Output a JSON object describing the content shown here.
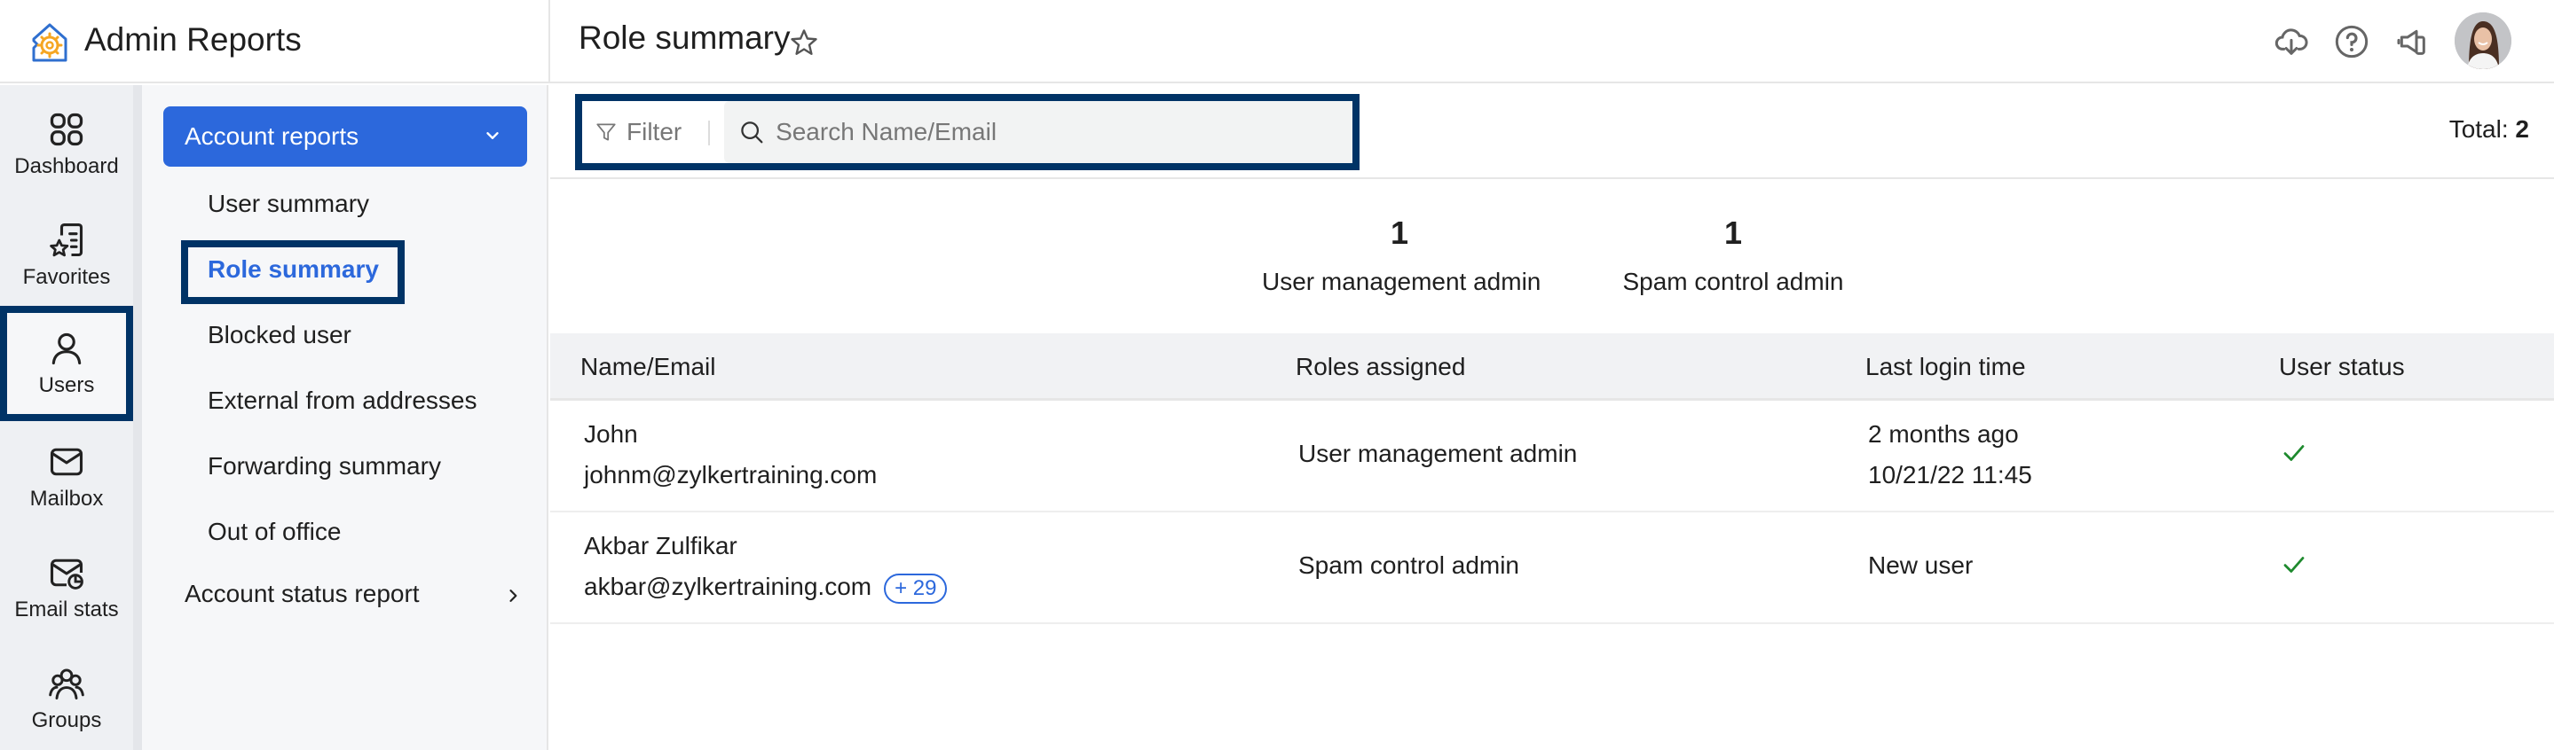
{
  "app": {
    "title": "Admin Reports",
    "logo_icon": "admin-reports-logo-icon"
  },
  "header": {
    "page_title": "Role summary",
    "favorite_icon": "star-icon",
    "actions": [
      {
        "name": "download",
        "icon": "cloud-download-icon"
      },
      {
        "name": "help",
        "icon": "help-icon"
      },
      {
        "name": "announcements",
        "icon": "megaphone-icon"
      }
    ],
    "avatar_icon": "user-avatar"
  },
  "rail": {
    "items": [
      {
        "label": "Dashboard",
        "icon": "grid-icon",
        "active": false
      },
      {
        "label": "Favorites",
        "icon": "favorites-list-icon",
        "active": false
      },
      {
        "label": "Users",
        "icon": "user-icon",
        "active": true
      },
      {
        "label": "Mailbox",
        "icon": "mail-icon",
        "active": false
      },
      {
        "label": "Email stats",
        "icon": "mail-stats-icon",
        "active": false
      },
      {
        "label": "Groups",
        "icon": "group-icon",
        "active": false
      }
    ]
  },
  "subnav": {
    "group_label": "Account reports",
    "items": [
      {
        "label": "User summary",
        "active": false
      },
      {
        "label": "Role summary",
        "active": true
      },
      {
        "label": "Blocked user",
        "active": false
      },
      {
        "label": "External from addresses",
        "active": false
      },
      {
        "label": "Forwarding summary",
        "active": false
      },
      {
        "label": "Out of office",
        "active": false
      }
    ],
    "group2_label": "Account status report"
  },
  "toolbar": {
    "filter_label": "Filter",
    "search_placeholder": "Search Name/Email",
    "search_value": "",
    "total_label": "Total:",
    "total_value": "2"
  },
  "stats": [
    {
      "count": "1",
      "label": "User management admin"
    },
    {
      "count": "1",
      "label": "Spam control admin"
    }
  ],
  "table": {
    "columns": [
      "Name/Email",
      "Roles assigned",
      "Last login time",
      "User status"
    ],
    "rows": [
      {
        "name": "John",
        "email": "johnm@zylkertraining.com",
        "extra_badge": "",
        "role": "User management admin",
        "last_login": "2 months ago",
        "last_login_time": "10/21/22 11:45",
        "status": "active"
      },
      {
        "name": "Akbar Zulfikar",
        "email": "akbar@zylkertraining.com",
        "extra_badge": "+ 29",
        "role": "Spam control admin",
        "last_login": "New user",
        "last_login_time": "",
        "status": "active"
      }
    ]
  },
  "colors": {
    "accent": "#2c68dc",
    "highlight_border": "#003366",
    "status_ok": "#1e8a2e"
  }
}
